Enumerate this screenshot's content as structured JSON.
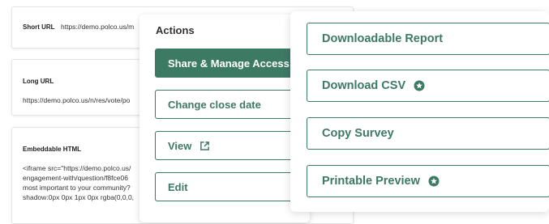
{
  "short_url": {
    "label": "Short URL",
    "value": "https://demo.polco.us/m"
  },
  "long_url": {
    "label": "Long URL",
    "value": "https://demo.polco.us/n/res/vote/po"
  },
  "embeddable_html": {
    "label": "Embeddable HTML",
    "lines": [
      "<iframe src=\"https://demo.polco.us/",
      "engagement-with/question/f8fce06",
      "most important to your community?",
      "shadow:0px 0px 1px 0px rgba(0,0,0,"
    ]
  },
  "actions": {
    "heading": "Actions",
    "share_manage_access": "Share & Manage Access",
    "change_close_date": "Change close date",
    "view": "View",
    "edit": "Edit"
  },
  "downloads": {
    "downloadable_report": "Downloadable Report",
    "download_csv": "Download CSV",
    "copy_survey": "Copy Survey",
    "printable_preview": "Printable Preview"
  },
  "colors": {
    "brand_green": "#3d7a63"
  }
}
